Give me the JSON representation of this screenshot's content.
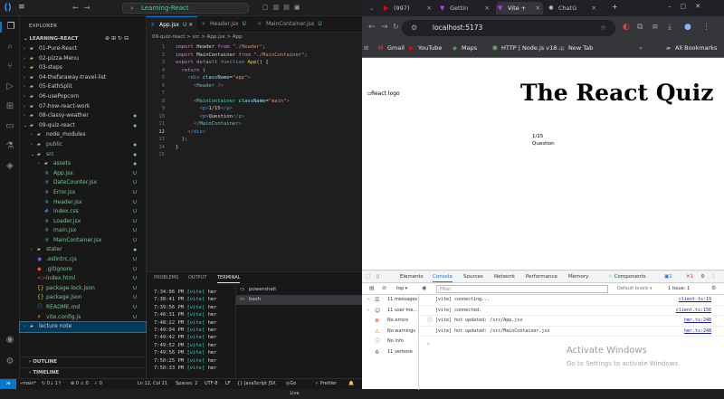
{
  "vscode": {
    "title_search": "Learning-React",
    "sidebar": {
      "header": "EXPLORER",
      "root": "LEARNING-REACT",
      "items": [
        {
          "label": "01-Pure-React",
          "depth": 1,
          "type": "folder",
          "open": false,
          "status": ""
        },
        {
          "label": "02-pizza-Menu",
          "depth": 1,
          "type": "folder",
          "open": false,
          "status": ""
        },
        {
          "label": "03-steps",
          "depth": 1,
          "type": "folder",
          "open": false,
          "status": ""
        },
        {
          "label": "04-thefaraway-travel-list",
          "depth": 1,
          "type": "folder",
          "open": false,
          "status": ""
        },
        {
          "label": "05-EathSplit",
          "depth": 1,
          "type": "folder",
          "open": false,
          "status": ""
        },
        {
          "label": "06-usePopcorn",
          "depth": 1,
          "type": "folder",
          "open": false,
          "status": ""
        },
        {
          "label": "07-how-react-work",
          "depth": 1,
          "type": "folder",
          "open": false,
          "status": ""
        },
        {
          "label": "08-classy-weather",
          "depth": 1,
          "type": "folder",
          "open": false,
          "status": "dot"
        },
        {
          "label": "09-quiz-react",
          "depth": 1,
          "type": "folder",
          "open": true,
          "status": "dot"
        },
        {
          "label": "node_modules",
          "depth": 2,
          "type": "folder",
          "open": false,
          "status": ""
        },
        {
          "label": "public",
          "depth": 2,
          "type": "folder",
          "open": false,
          "status": "dot"
        },
        {
          "label": "src",
          "depth": 2,
          "type": "folder",
          "open": true,
          "status": "dot"
        },
        {
          "label": "assets",
          "depth": 3,
          "type": "folder",
          "open": false,
          "status": "dot"
        },
        {
          "label": "App.jsx",
          "depth": 3,
          "type": "react",
          "open": false,
          "status": "U"
        },
        {
          "label": "DateCounter.jsx",
          "depth": 3,
          "type": "react",
          "open": false,
          "status": "U"
        },
        {
          "label": "Error.jsx",
          "depth": 3,
          "type": "react",
          "open": false,
          "status": "U"
        },
        {
          "label": "Header.jsx",
          "depth": 3,
          "type": "react",
          "open": false,
          "status": "U"
        },
        {
          "label": "index.css",
          "depth": 3,
          "type": "css",
          "open": false,
          "status": "U"
        },
        {
          "label": "Loader.jsx",
          "depth": 3,
          "type": "react",
          "open": false,
          "status": "U"
        },
        {
          "label": "main.jsx",
          "depth": 3,
          "type": "react",
          "open": false,
          "status": "U"
        },
        {
          "label": "MainContainer.jsx",
          "depth": 3,
          "type": "react",
          "open": false,
          "status": "U"
        },
        {
          "label": "stater",
          "depth": 2,
          "type": "folder",
          "open": false,
          "status": "dot"
        },
        {
          "label": ".eslintrc.cjs",
          "depth": 2,
          "type": "eslint",
          "open": false,
          "status": "U"
        },
        {
          "label": ".gitignore",
          "depth": 2,
          "type": "git",
          "open": false,
          "status": "U"
        },
        {
          "label": "index.html",
          "depth": 2,
          "type": "html",
          "open": false,
          "status": "U"
        },
        {
          "label": "package-lock.json",
          "depth": 2,
          "type": "json",
          "open": false,
          "status": "U"
        },
        {
          "label": "package.json",
          "depth": 2,
          "type": "json",
          "open": false,
          "status": "U"
        },
        {
          "label": "README.md",
          "depth": 2,
          "type": "md",
          "open": false,
          "status": "U"
        },
        {
          "label": "vite.config.js",
          "depth": 2,
          "type": "js",
          "open": false,
          "status": "U"
        },
        {
          "label": "lecture note",
          "depth": 1,
          "type": "folder",
          "open": false,
          "status": "",
          "selected": true
        }
      ],
      "outline": "OUTLINE",
      "timeline": "TIMELINE"
    },
    "tabs": [
      {
        "label": "App.jsx",
        "status": "U",
        "active": true
      },
      {
        "label": "Header.jsx",
        "status": "U",
        "active": false
      },
      {
        "label": "MainContainer.jsx",
        "status": "U",
        "active": false
      }
    ],
    "breadcrumb": "09-quiz-react > src > App.jsx > App",
    "code": [
      {
        "n": "1",
        "segs": [
          [
            "k",
            "import "
          ],
          [
            "w",
            "Header "
          ],
          [
            "k",
            "from "
          ],
          [
            "s",
            "\"./Header\""
          ],
          [
            "w",
            ";"
          ]
        ]
      },
      {
        "n": "2",
        "segs": [
          [
            "k",
            "import "
          ],
          [
            "w",
            "MainContainer "
          ],
          [
            "k",
            "from "
          ],
          [
            "s",
            "\"./MainContainer\""
          ],
          [
            "w",
            ";"
          ]
        ]
      },
      {
        "n": "3",
        "segs": [
          [
            "k",
            "export default "
          ],
          [
            "kb",
            "function "
          ],
          [
            "y",
            "App"
          ],
          [
            "w",
            "() {"
          ]
        ]
      },
      {
        "n": "4",
        "segs": [
          [
            "k",
            "  return "
          ],
          [
            "w",
            "("
          ]
        ]
      },
      {
        "n": "5",
        "segs": [
          [
            "p",
            "    <"
          ],
          [
            "kb",
            "div "
          ],
          [
            "a",
            "className"
          ],
          [
            "w",
            "="
          ],
          [
            "s",
            "\"app\""
          ],
          [
            "p",
            ">"
          ]
        ]
      },
      {
        "n": "6",
        "segs": [
          [
            "p",
            "      <"
          ],
          [
            "t",
            "Header "
          ],
          [
            "p",
            "/>"
          ]
        ]
      },
      {
        "n": "7",
        "segs": [
          [
            "w",
            ""
          ]
        ]
      },
      {
        "n": "8",
        "segs": [
          [
            "p",
            "      <"
          ],
          [
            "t",
            "MainContainer "
          ],
          [
            "a",
            "className"
          ],
          [
            "w",
            "="
          ],
          [
            "s",
            "\"main\""
          ],
          [
            "p",
            ">"
          ]
        ]
      },
      {
        "n": "9",
        "segs": [
          [
            "p",
            "        <"
          ],
          [
            "kb",
            "p"
          ],
          [
            "p",
            ">"
          ],
          [
            "w",
            "1/15"
          ],
          [
            "p",
            "</"
          ],
          [
            "kb",
            "p"
          ],
          [
            "p",
            ">"
          ]
        ]
      },
      {
        "n": "10",
        "segs": [
          [
            "p",
            "        <"
          ],
          [
            "kb",
            "p"
          ],
          [
            "p",
            ">"
          ],
          [
            "w",
            "Question"
          ],
          [
            "p",
            "</"
          ],
          [
            "kb",
            "p"
          ],
          [
            "p",
            ">"
          ]
        ]
      },
      {
        "n": "11",
        "segs": [
          [
            "p",
            "      </"
          ],
          [
            "t",
            "MainContainer"
          ],
          [
            "p",
            ">"
          ]
        ]
      },
      {
        "n": "12",
        "segs": [
          [
            "p",
            "    </"
          ],
          [
            "kb",
            "div"
          ],
          [
            "p",
            ">"
          ]
        ],
        "current": true
      },
      {
        "n": "13",
        "segs": [
          [
            "w",
            "  );"
          ]
        ]
      },
      {
        "n": "14",
        "segs": [
          [
            "w",
            "}"
          ]
        ]
      },
      {
        "n": "15",
        "segs": [
          [
            "w",
            ""
          ]
        ]
      }
    ],
    "panel": {
      "tabs": [
        "PROBLEMS",
        "OUTPUT",
        "TERMINAL"
      ],
      "active_tab": "TERMINAL",
      "terminal_lines": [
        {
          "time": "7:34:06 PM",
          "tag": "[vite]",
          "text": "hmr"
        },
        {
          "time": "7:38:41 PM",
          "tag": "[vite]",
          "text": "hmr"
        },
        {
          "time": "7:39:56 PM",
          "tag": "[vite]",
          "text": "hmr"
        },
        {
          "time": "7:46:31 PM",
          "tag": "[vite]",
          "text": "hmr"
        },
        {
          "time": "7:48:22 PM",
          "tag": "[vite]",
          "text": "hmr"
        },
        {
          "time": "7:49:04 PM",
          "tag": "[vite]",
          "text": "hmr"
        },
        {
          "time": "7:49:42 PM",
          "tag": "[vite]",
          "text": "hmr"
        },
        {
          "time": "7:49:52 PM",
          "tag": "[vite]",
          "text": "hmr"
        },
        {
          "time": "7:49:56 PM",
          "tag": "[vite]",
          "text": "hmr"
        },
        {
          "time": "7:50:25 PM",
          "tag": "[vite]",
          "text": "hmr"
        },
        {
          "time": "7:50:33 PM",
          "tag": "[vite]",
          "text": "hmr"
        }
      ],
      "shells": [
        {
          "label": "powershell",
          "selected": false
        },
        {
          "label": "bash",
          "selected": true
        }
      ]
    },
    "statusbar": {
      "branch": "main*",
      "sync": "↻ 0↓ 1↑",
      "problems": "⊗ 0 ⚠ 0",
      "ports": "✓ 0",
      "position": "Ln 12, Col 11",
      "spaces": "Spaces: 2",
      "encoding": "UTF-8",
      "eol": "LF",
      "language": "{} JavaScript JSX",
      "golive": "Go Live",
      "prettier": "✓ Prettier"
    }
  },
  "browser": {
    "tabs": [
      {
        "label": "(997)",
        "icon": "youtube-icon",
        "active": false
      },
      {
        "label": "Gettin",
        "icon": "vite-icon",
        "active": false
      },
      {
        "label": "Vite +",
        "icon": "vite-icon",
        "active": true
      },
      {
        "label": "ChatG",
        "icon": "chatgpt-icon",
        "active": false
      }
    ],
    "url": "localhost:5173",
    "bookmarks": [
      {
        "label": "Gmail",
        "icon": "gmail-icon"
      },
      {
        "label": "YouTube",
        "icon": "youtube-icon"
      },
      {
        "label": "Maps",
        "icon": "maps-icon"
      },
      {
        "label": "HTTP | Node.js v18....",
        "icon": "node-icon"
      },
      {
        "label": "New Tab",
        "icon": "globe-icon"
      },
      {
        "label": "All Bookmarks",
        "icon": "folder-icon"
      }
    ],
    "page": {
      "logo_alt": "React logo",
      "title": "The React Quiz",
      "question_num": "1/15",
      "question": "Question"
    },
    "devtools": {
      "tabs": [
        "Elements",
        "Console",
        "Sources",
        "Network",
        "Performance",
        "Memory",
        "Components"
      ],
      "active_tab": "Console",
      "context": "top",
      "filter_placeholder": "Filter",
      "levels": "Default levels",
      "issues": "1 Issue: 1",
      "side": [
        {
          "label": "11 messages",
          "icon": "list-icon"
        },
        {
          "label": "11 user me...",
          "icon": "user-icon"
        },
        {
          "label": "No errors",
          "icon": "error-icon"
        },
        {
          "label": "No warnings",
          "icon": "warning-icon"
        },
        {
          "label": "No info",
          "icon": "info-icon"
        },
        {
          "label": "11 verbose",
          "icon": "verbose-icon"
        }
      ],
      "messages": [
        {
          "text": "[vite] connecting...",
          "source": "client.ts:19"
        },
        {
          "text": "[vite] connected.",
          "source": "client.ts:156"
        },
        {
          "text": "[vite] hot updated: /src/App.jsx",
          "source": "hmr.ts:248"
        },
        {
          "text": "[vite] hot updated: /src/MainContainer.jsx",
          "source": "hmr.ts:248"
        }
      ]
    }
  },
  "watermark": {
    "line1": "Activate Windows",
    "line2": "Go to Settings to activate Windows."
  }
}
